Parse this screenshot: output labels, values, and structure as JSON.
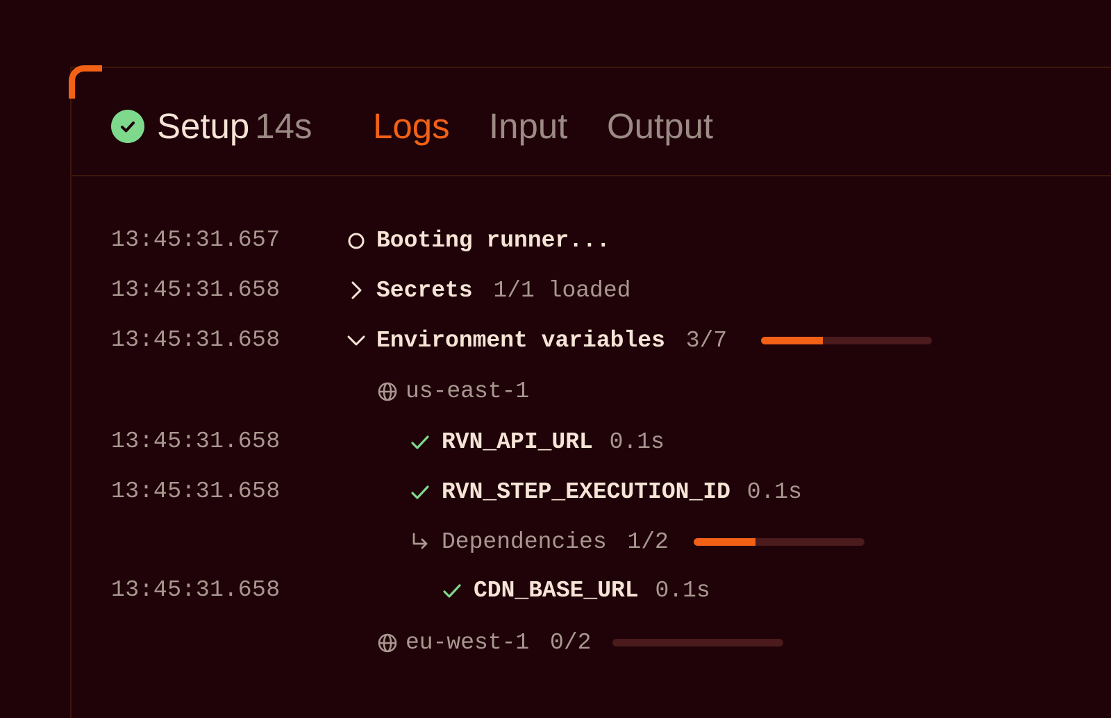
{
  "header": {
    "status": "success",
    "step_name": "Setup",
    "step_duration": "14s",
    "tabs": [
      {
        "label": "Logs",
        "active": true
      },
      {
        "label": "Input",
        "active": false
      },
      {
        "label": "Output",
        "active": false
      }
    ]
  },
  "colors": {
    "background": "#1f0309",
    "accent": "#f26116",
    "success": "#7fd98c",
    "text": "#f6e4d6",
    "muted": "#9c8a84"
  },
  "logs": [
    {
      "timestamp": "13:45:31.657",
      "icon": "circle-icon",
      "label": "Booting runner..."
    },
    {
      "timestamp": "13:45:31.658",
      "icon": "chevron-right-icon",
      "label": "Secrets",
      "detail": "1/1 loaded"
    },
    {
      "timestamp": "13:45:31.658",
      "icon": "chevron-down-icon",
      "label": "Environment variables",
      "detail": "3/7",
      "progress": 0.36
    },
    {
      "timestamp": "",
      "icon": "globe-icon",
      "label": "us-east-1"
    },
    {
      "timestamp": "13:45:31.658",
      "icon": "check-icon",
      "label": "RVN_API_URL",
      "detail": "0.1s"
    },
    {
      "timestamp": "13:45:31.658",
      "icon": "check-icon",
      "label": "RVN_STEP_EXECUTION_ID",
      "detail": "0.1s"
    },
    {
      "timestamp": "",
      "icon": "return-arrow-icon",
      "label": "Dependencies",
      "detail": "1/2",
      "progress": 0.36
    },
    {
      "timestamp": "13:45:31.658",
      "icon": "check-icon",
      "label": "CDN_BASE_URL",
      "detail": "0.1s"
    },
    {
      "timestamp": "",
      "icon": "globe-icon",
      "label": "eu-west-1",
      "detail": "0/2",
      "progress": 0
    }
  ]
}
